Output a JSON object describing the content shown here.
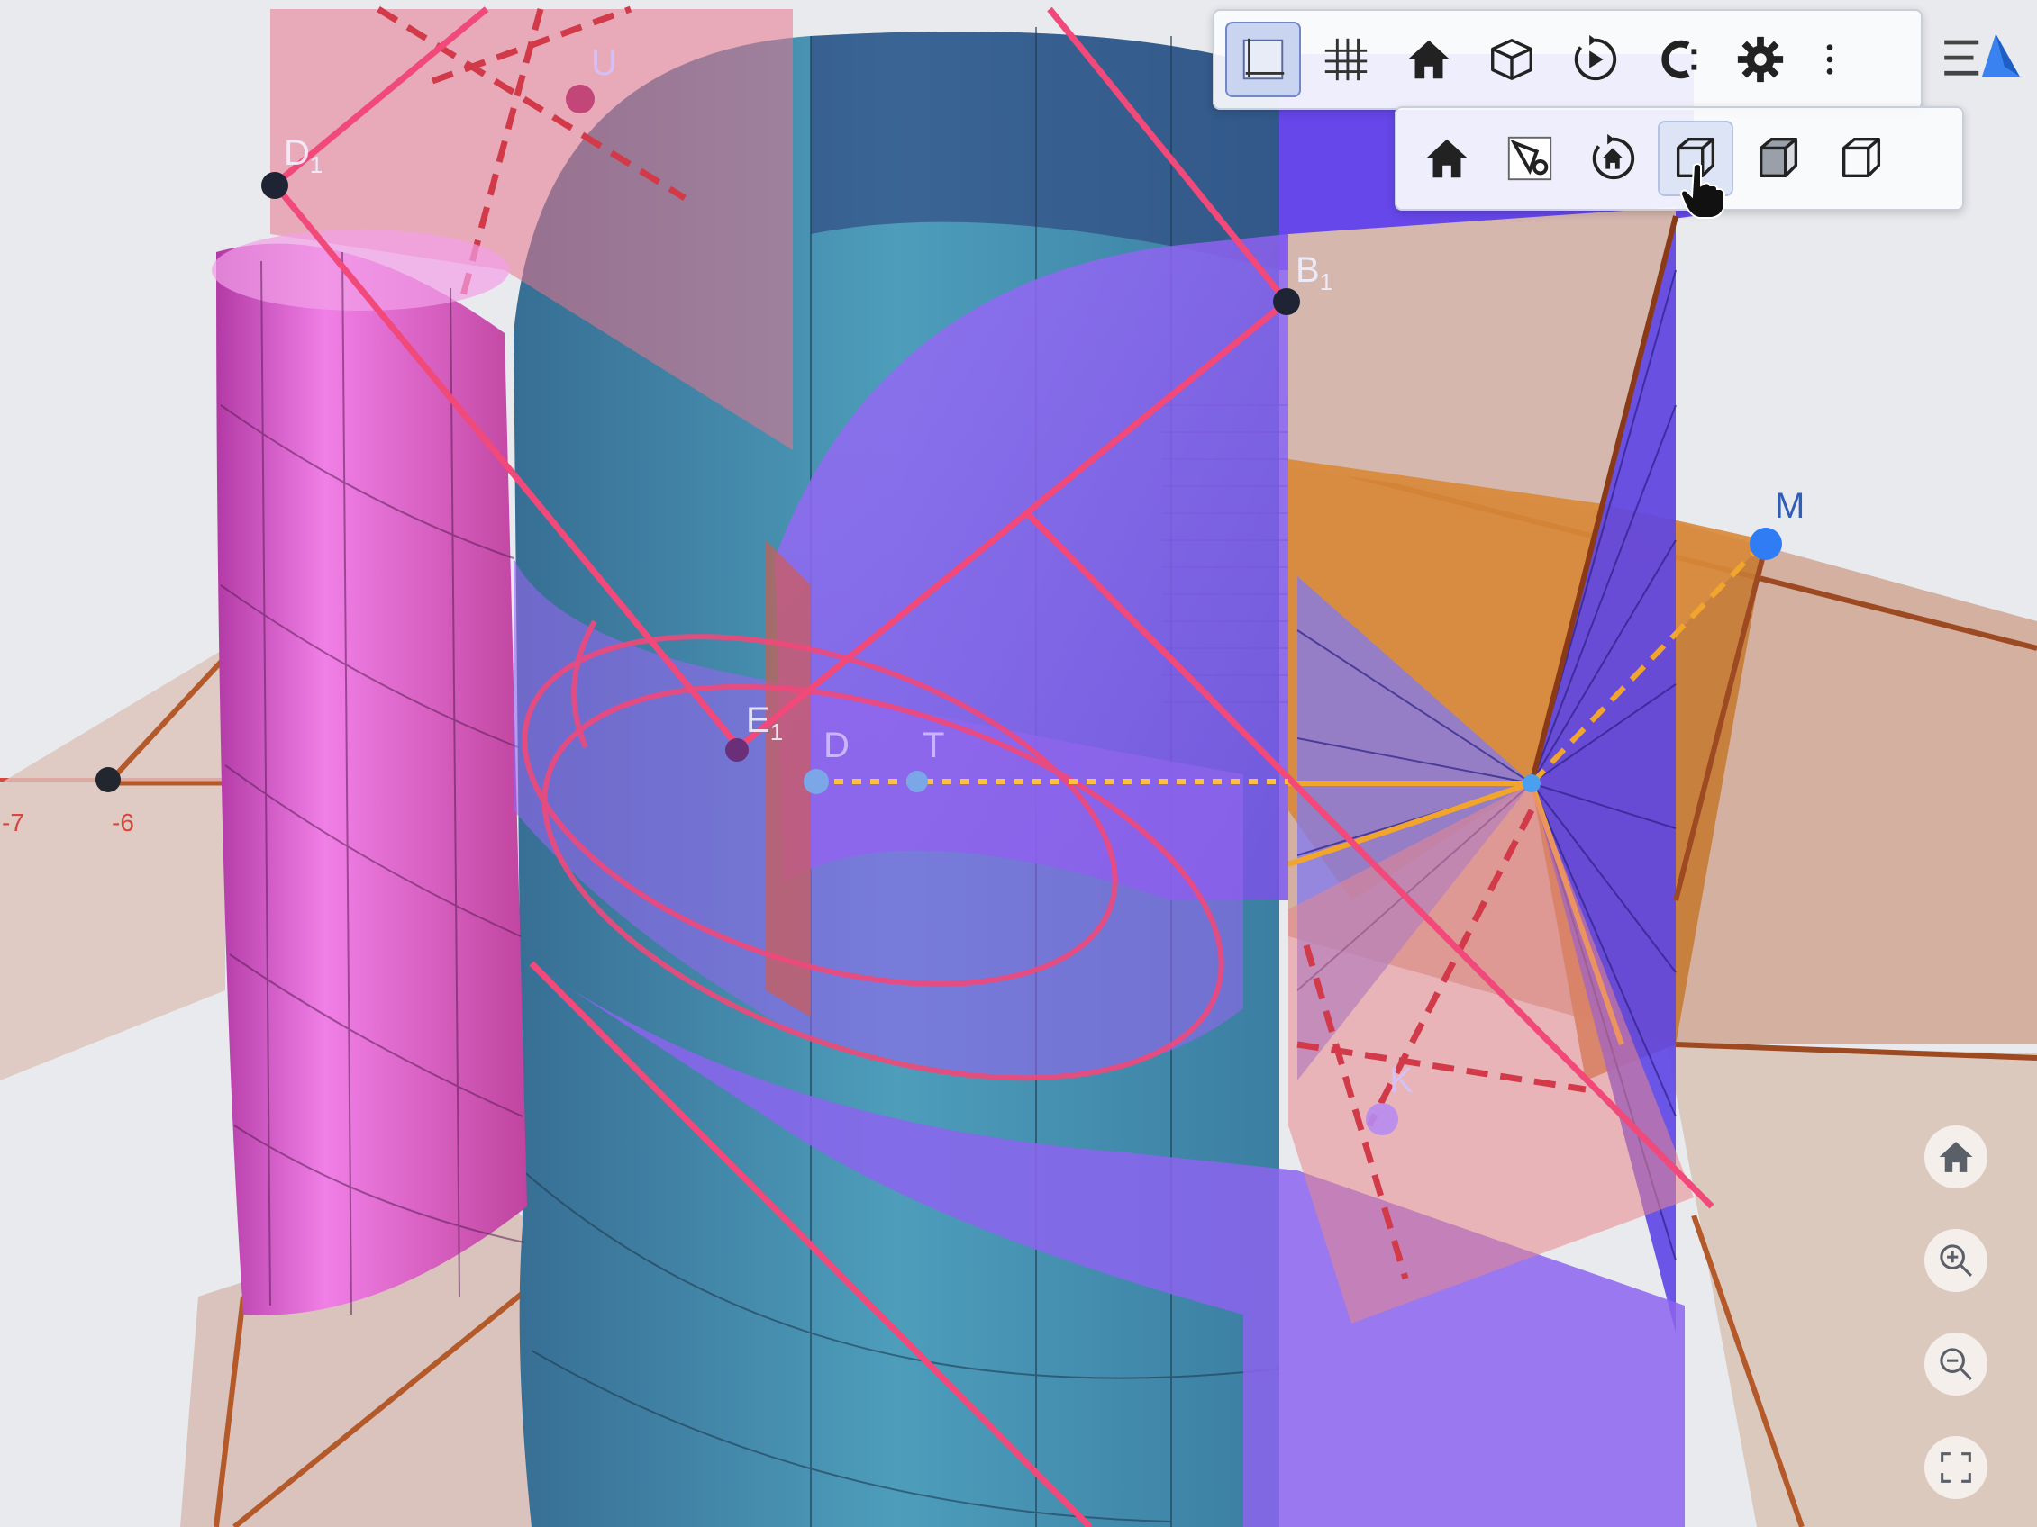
{
  "toolbar": {
    "buttons": [
      {
        "icon": "axes-icon",
        "state": "active"
      },
      {
        "icon": "grid-icon"
      },
      {
        "icon": "home-icon"
      },
      {
        "icon": "cube-icon"
      },
      {
        "icon": "rotate-icon"
      },
      {
        "icon": "projection-icon"
      },
      {
        "icon": "gear-icon"
      },
      {
        "icon": "more-vertical-icon"
      }
    ],
    "view_menu_icon": "view-3d-menu-icon"
  },
  "view_submenu": {
    "buttons": [
      {
        "icon": "home-icon"
      },
      {
        "icon": "view-in-front-of-icon"
      },
      {
        "icon": "rotate-home-icon"
      },
      {
        "icon": "front-view-cube-icon",
        "state": "hover"
      },
      {
        "icon": "side-view-cube-icon"
      },
      {
        "icon": "top-view-cube-icon"
      }
    ]
  },
  "points": {
    "d1": {
      "base": "D",
      "sub": "1"
    },
    "b1": {
      "base": "B",
      "sub": "1"
    },
    "e1": {
      "base": "E",
      "sub": "1"
    },
    "d": "D",
    "t": "T",
    "m": "M",
    "k": "K",
    "u": "U"
  },
  "axis": {
    "tick_minus7": "-7",
    "tick_minus6": "-6"
  },
  "colors": {
    "magenta_cylinder": "#d94fd0",
    "teal_cylinder": "#3f8cae",
    "purple_surface": "#8a5cf0",
    "orange_plane": "#d08036",
    "red_lines": "#f0497a",
    "toolbar_active": "#c9d4f0"
  },
  "side_controls": [
    "home-icon",
    "zoom-in-icon",
    "zoom-out-icon",
    "fullscreen-icon"
  ]
}
